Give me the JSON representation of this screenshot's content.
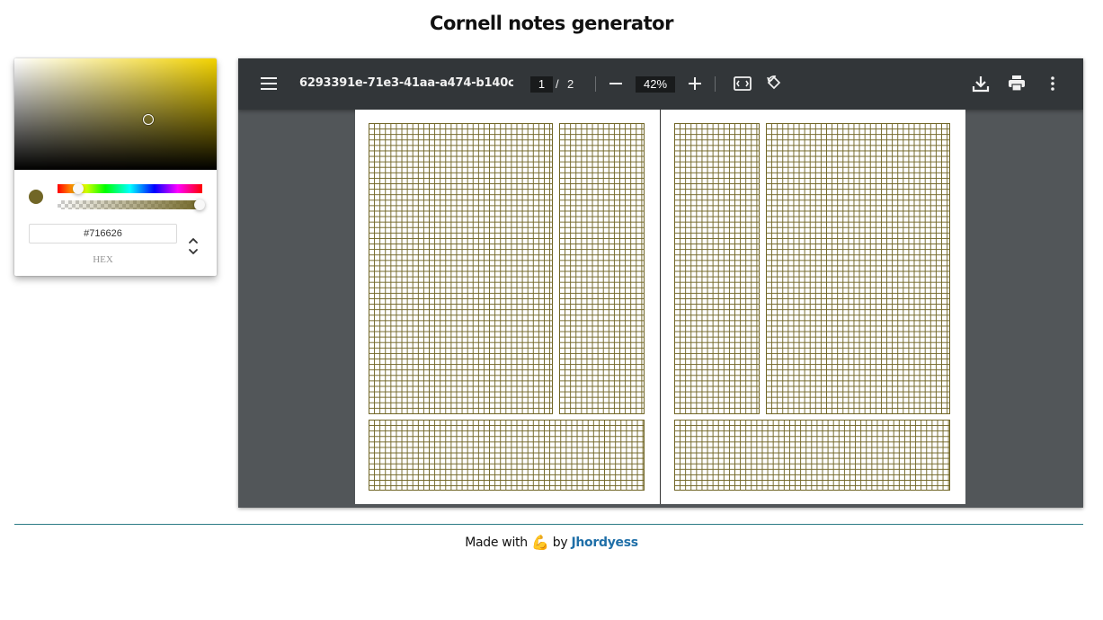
{
  "page": {
    "title": "Cornell notes generator"
  },
  "color_picker": {
    "hex_value": "#716626",
    "hex_label": "HEX",
    "swatch_color": "#716626",
    "hue_color": "#f2d200"
  },
  "pdf_viewer": {
    "file_name": "6293391e-71e3-41aa-a474-b140cde...",
    "current_page": "1",
    "page_separator": "/",
    "total_pages": "2",
    "zoom": "42%",
    "grid_color": "#716626"
  },
  "footer": {
    "made_with": "Made with",
    "emoji": "💪",
    "by": "by",
    "author": "Jhordyess"
  }
}
